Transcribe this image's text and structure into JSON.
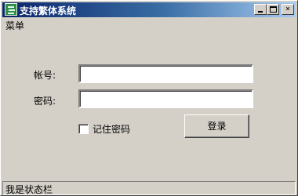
{
  "window": {
    "title": "支持繁体系统",
    "icon": "app-icon",
    "controls": {
      "minimize": "minimize-icon",
      "maximize": "maximize-icon",
      "close_label": "×"
    }
  },
  "menu": {
    "items": [
      {
        "label": "菜单"
      }
    ]
  },
  "form": {
    "account_label": "帐号:",
    "account_value": "",
    "password_label": "密码:",
    "password_value": "",
    "remember_label": "记住密码",
    "remember_checked": false,
    "login_label": "登录"
  },
  "statusbar": {
    "text": "我是状态栏"
  }
}
